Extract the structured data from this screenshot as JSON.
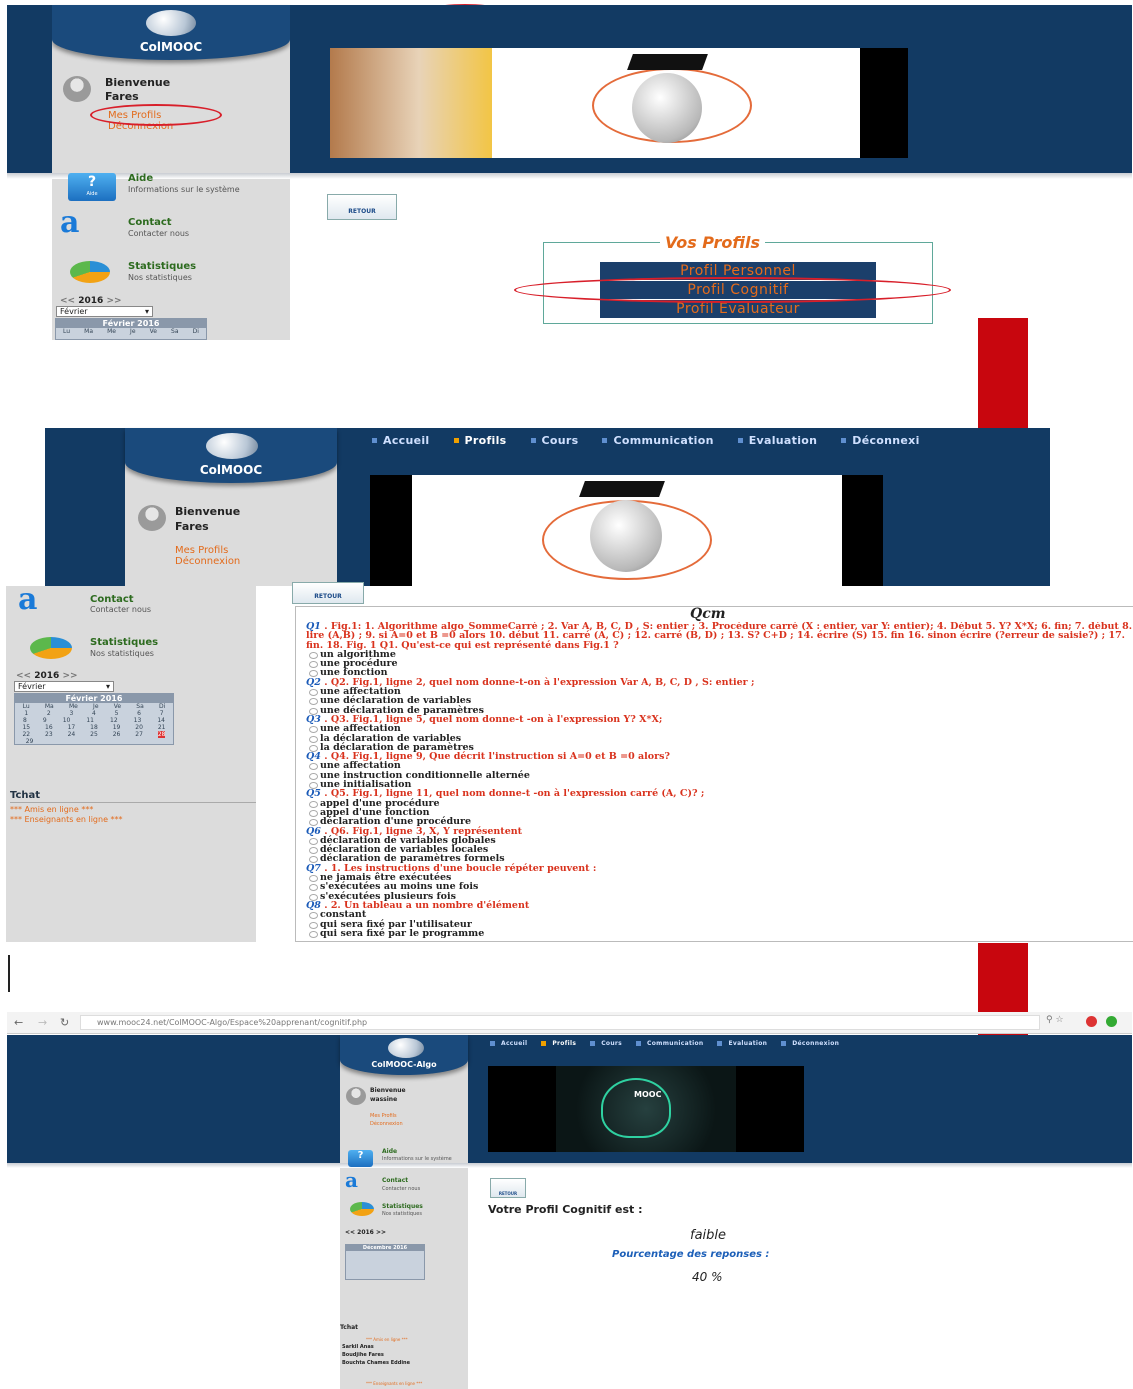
{
  "nav_items": [
    "Accueil",
    "Profils",
    "Cours",
    "Communication",
    "Evaluation",
    "Déconnexion"
  ],
  "nav_items_truncated": [
    "Accueil",
    "Profils",
    "Cours",
    "Communication",
    "Evaluation",
    "Déconnexi"
  ],
  "logo": "ColMOOC",
  "logo3": "ColMOOC-Algo",
  "welcome": "Bienvenue",
  "user": "Fares",
  "user3": "wassine",
  "links": {
    "profils": "Mes Profils",
    "deco": "Déconnexion"
  },
  "aide": {
    "title": "Aide",
    "desc": "Informations sur le système",
    "badge": "Aide"
  },
  "contact": {
    "title": "Contact",
    "desc": "Contacter nous"
  },
  "stats": {
    "title": "Statistiques",
    "desc": "Nos statistiques"
  },
  "year": "2016",
  "year_nav_prev": "<<",
  "year_nav_next": ">>",
  "month": "Février",
  "cal_title": "Février 2016",
  "cal_title3": "Décembre 2016",
  "retour": "RETOUR",
  "vos_profils": "Vos Profils",
  "profile_buttons": [
    "Profil Personnel",
    "Profil Cognitif",
    "Profil Evaluateur"
  ],
  "qcm_title": "Qcm",
  "tchat": {
    "title": "Tchat",
    "amis": "*** Amis en ligne ***",
    "enseignants": "*** Enseignants en ligne ***"
  },
  "tchat3": {
    "users": [
      "Sarkil Anas",
      "Boudjihe Fares",
      "Bouchta Chames Eddine"
    ]
  },
  "qcm": [
    {
      "n": "Q1",
      "text": ". Fig.1: 1. Algorithme algo_SommeCarré ; 2. Var A, B, C, D , S: entier ; 3. Procédure carré (X : entier, var Y: entier); 4. Début 5. Y? X*X; 6. fin; 7. début 8. lire (A,B) ; 9. si A=0 et B =0 alors 10. début 11. carré (A, C) ; 12. carré (B, D) ; 13. S? C+D ; 14. écrire (S) 15. fin 16. sinon écrire (?erreur de saisie?) ; 17. fin. 18. Fig. 1 Q1. Qu'est-ce qui est représenté dans Fig.1 ?",
      "answers": [
        "un algorithme",
        "une procédure",
        "une fonction"
      ]
    },
    {
      "n": "Q2",
      "text": ". Q2. Fig.1, ligne 2, quel nom donne-t-on à l'expression Var A, B, C, D , S: entier ;",
      "answers": [
        "une affectation",
        "une déclaration de variables",
        "une déclaration de paramètres"
      ]
    },
    {
      "n": "Q3",
      "text": ". Q3. Fig.1, ligne 5, quel nom donne-t -on à l'expression Y? X*X;",
      "answers": [
        "une affectation",
        "la déclaration de variables",
        "la déclaration de paramètres"
      ]
    },
    {
      "n": "Q4",
      "text": ". Q4. Fig.1, ligne 9, Que décrit l'instruction si A=0 et B =0 alors?",
      "answers": [
        "une affectation",
        "une instruction conditionnelle alternée",
        "une initialisation"
      ]
    },
    {
      "n": "Q5",
      "text": ". Q5. Fig.1, ligne 11, quel nom donne-t -on à l'expression carré (A, C)? ;",
      "answers": [
        "appel d'une procédure",
        "appel d'une fonction",
        "déclaration d'une procédure"
      ]
    },
    {
      "n": "Q6",
      "text": ". Q6. Fig.1, ligne 3, X, Y représentent",
      "answers": [
        "déclaration de variables globales",
        "déclaration de variables locales",
        "déclaration de paramètres formels"
      ]
    },
    {
      "n": "Q7",
      "text": ". 1. Les instructions d'une boucle répéter peuvent :",
      "answers": [
        "ne jamais être exécutées",
        "s'exécutées au moins une fois",
        "s'exécutées plusieurs fois"
      ]
    },
    {
      "n": "Q8",
      "text": ". 2. Un tableau a un nombre d'élément",
      "answers": [
        "constant",
        "qui sera fixé par l'utilisateur",
        "qui sera fixé par le programme"
      ]
    }
  ],
  "browser_url": "www.mooc24.net/ColMOOC-Algo/Espace%20apprenant/cognitif.php",
  "result": {
    "heading": "Votre Profil Cognitif est :",
    "level": "faible",
    "pct_label": "Pourcentage des reponses :",
    "pct": "40 %"
  },
  "mooc_label": "MOOC",
  "colors": {
    "nav": "#123a63",
    "accent": "#e36b1c",
    "arrow": "#c8060e",
    "oval": "#d81f2a"
  }
}
